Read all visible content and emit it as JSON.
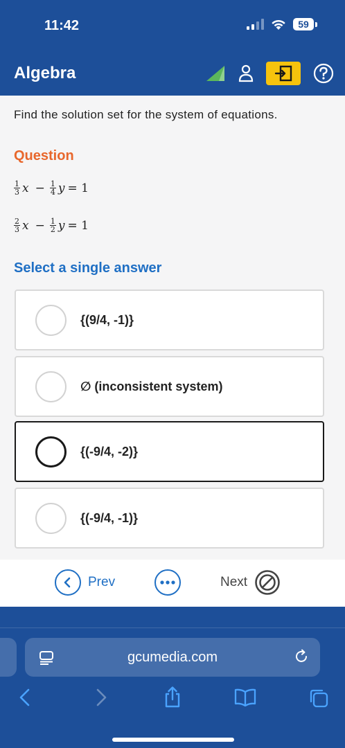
{
  "status_bar": {
    "time": "11:42",
    "battery": "59"
  },
  "header": {
    "title": "Algebra"
  },
  "instruction": "Find the solution set for the system of equations.",
  "question_heading": "Question",
  "equations": [
    {
      "a_num": "1",
      "a_den": "3",
      "x": "x",
      "op": "−",
      "b_num": "1",
      "b_den": "4",
      "y": "y",
      "rhs": "= 1"
    },
    {
      "a_num": "2",
      "a_den": "3",
      "x": "x",
      "op": "−",
      "b_num": "1",
      "b_den": "2",
      "y": "y",
      "rhs": "= 1"
    }
  ],
  "select_heading": "Select a single answer",
  "options": [
    {
      "label": "{(9/4, -1)}",
      "selected": false
    },
    {
      "label": "∅ (inconsistent system)",
      "selected": false
    },
    {
      "label": "{(-9/4, -2)}",
      "selected": true
    },
    {
      "label": "{(-9/4, -1)}",
      "selected": false
    }
  ],
  "nav": {
    "prev_label": "Prev",
    "next_label": "Next"
  },
  "browser": {
    "url": "gcumedia.com"
  },
  "colors": {
    "primary": "#1d4f99",
    "accent_orange": "#e8672c",
    "link_blue": "#1f6fc4",
    "exit_yellow": "#f6c30d",
    "triangle_green": "#5cb85c"
  }
}
